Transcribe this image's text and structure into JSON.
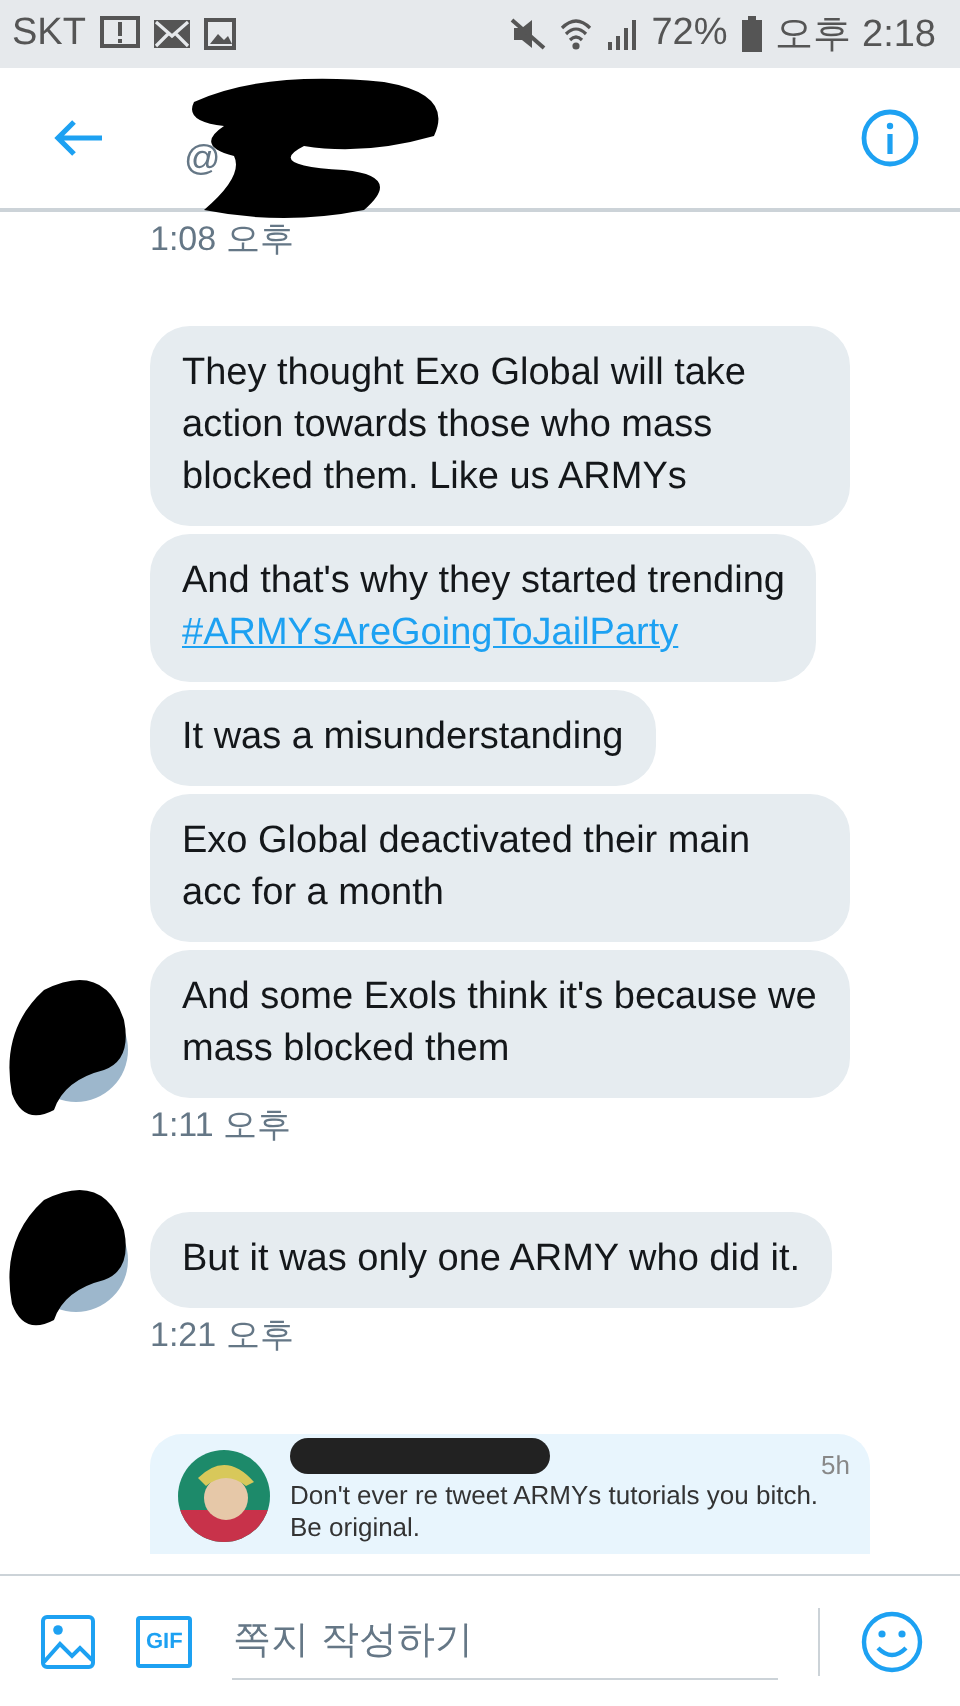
{
  "status_bar": {
    "carrier": "SKT",
    "battery": "72%",
    "time": "오후 2:18"
  },
  "header": {
    "handle": "@"
  },
  "top_timestamp": "1:08 오후",
  "groups": [
    {
      "messages": [
        {
          "parts": [
            {
              "kind": "text",
              "text": "They thought Exo Global will take action towards those who mass blocked them. Like us ARMYs"
            }
          ]
        },
        {
          "parts": [
            {
              "kind": "text",
              "text": "And that's why they started trending"
            },
            {
              "kind": "link",
              "text": "#ARMYsAreGoingToJailParty"
            }
          ]
        },
        {
          "parts": [
            {
              "kind": "text",
              "text": "It was a misunderstanding"
            }
          ]
        },
        {
          "parts": [
            {
              "kind": "text",
              "text": "Exo Global deactivated their main acc for a month"
            }
          ]
        },
        {
          "parts": [
            {
              "kind": "text",
              "text": "And some Exols think it's because we mass blocked them"
            }
          ]
        }
      ],
      "time": "1:11 오후"
    },
    {
      "messages": [
        {
          "parts": [
            {
              "kind": "text",
              "text": "But it was only one ARMY who did it."
            }
          ]
        }
      ],
      "time": "1:21 오후"
    }
  ],
  "quoted_tweet": {
    "age": "5h",
    "text": "Don't ever re tweet ARMYs tutorials you bitch. Be original."
  },
  "composer": {
    "placeholder": "쪽지 작성하기",
    "gif_label": "GIF"
  }
}
